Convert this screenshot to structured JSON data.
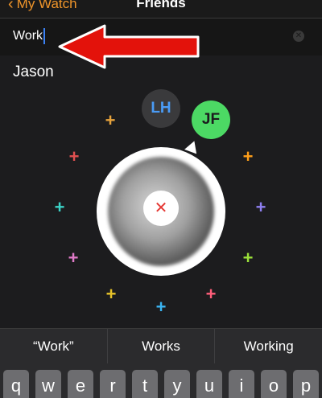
{
  "nav": {
    "back_label": "My Watch",
    "title": "Friends"
  },
  "search": {
    "value": "Work"
  },
  "result": {
    "name": "Jason"
  },
  "watch": {
    "avatars": [
      {
        "initials": "LH",
        "bg": "#3a3a3c",
        "fg": "#4a9bf5"
      },
      {
        "initials": "JF",
        "bg": "#4cd964",
        "fg": "#1c1c1e"
      }
    ],
    "remove_symbol": "✕",
    "plus_symbol": "+",
    "plus_colors": [
      "#e6a23c",
      "#e05050",
      "#ff9f1a",
      "#3cd3c7",
      "#8e7ff0",
      "#e07ac8",
      "#9be03a",
      "#e6c229",
      "#ff5e7a",
      "#3ab4f2"
    ]
  },
  "suggestions": [
    "“Work”",
    "Works",
    "Working"
  ],
  "keyboard": {
    "keys": [
      "q",
      "w",
      "e",
      "r",
      "t",
      "y",
      "u",
      "i",
      "o",
      "p"
    ]
  },
  "colors": {
    "accent": "#f0952a",
    "arrow": "#e3120b"
  }
}
